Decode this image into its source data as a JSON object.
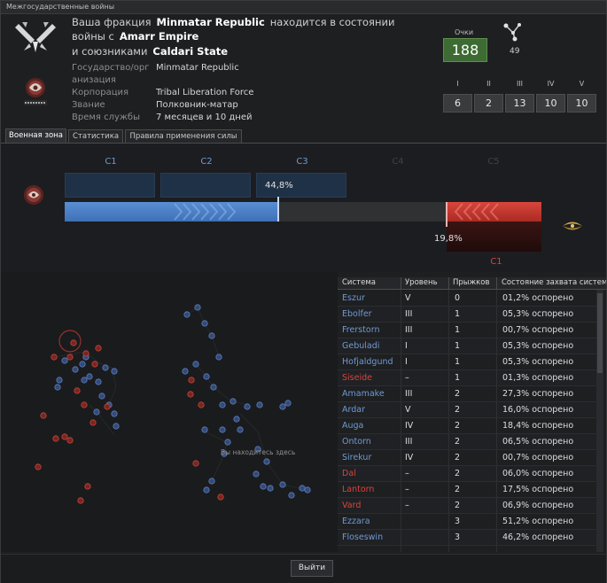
{
  "window": {
    "title": "Межгосударственные войны"
  },
  "header": {
    "line1_pre": "Ваша фракция",
    "line1_faction": "Minmatar Republic",
    "line1_post": "находится в состоянии",
    "line2_pre": "войны с",
    "line2_enemy": "Amarr Empire",
    "line3_pre": "и союзниками",
    "line3_ally": "Caldari State"
  },
  "info": [
    {
      "label": "Государство/орг",
      "value": "Minmatar Republic"
    },
    {
      "label": "анизация",
      "value": ""
    },
    {
      "label": "Корпорация",
      "value": "Tribal Liberation Force"
    },
    {
      "label": "Звание",
      "value": "Полковник-матар"
    },
    {
      "label": "Время службы",
      "value": "7 месяцев и 10 дней"
    }
  ],
  "stats": {
    "points_label": "Очки",
    "points_value": "188",
    "pilots_icon": "pilots-network-icon",
    "pilots_count": "49"
  },
  "ranks": [
    {
      "label": "I",
      "value": "6"
    },
    {
      "label": "II",
      "value": "2"
    },
    {
      "label": "III",
      "value": "13"
    },
    {
      "label": "IV",
      "value": "10"
    },
    {
      "label": "V",
      "value": "10"
    }
  ],
  "tabs": [
    {
      "label": "Военная зона",
      "active": true
    },
    {
      "label": "Статистика",
      "active": false
    },
    {
      "label": "Правила применения силы",
      "active": false
    }
  ],
  "warzone": {
    "levels": [
      "C1",
      "C2",
      "C3",
      "C4",
      "C5"
    ],
    "levels_active": 3,
    "ally_percent_label": "44,8%",
    "ally_percent": 44.8,
    "enemy_percent_label": "19,8%",
    "enemy_percent": 19.8,
    "enemy_level": "C1",
    "colors": {
      "ally": "#4f83c9",
      "enemy": "#c8372f"
    }
  },
  "map": {
    "caption": "Вы находитесь здесь"
  },
  "table": {
    "headers": [
      "Система",
      "Уровень",
      "Прыжков",
      "Состояние захвата систем"
    ],
    "rows": [
      {
        "system": "Eszur",
        "side": "ally",
        "level": "V",
        "jumps": "0",
        "state": "01,2% оспорено"
      },
      {
        "system": "Ebolfer",
        "side": "ally",
        "level": "III",
        "jumps": "1",
        "state": "05,3% оспорено"
      },
      {
        "system": "Frerstorn",
        "side": "ally",
        "level": "III",
        "jumps": "1",
        "state": "00,7% оспорено"
      },
      {
        "system": "Gebuladi",
        "side": "ally",
        "level": "I",
        "jumps": "1",
        "state": "05,3% оспорено"
      },
      {
        "system": "Hofjaldgund",
        "side": "ally",
        "level": "I",
        "jumps": "1",
        "state": "05,3% оспорено"
      },
      {
        "system": "Siseide",
        "side": "enemy",
        "level": "–",
        "jumps": "1",
        "state": "01,3% оспорено"
      },
      {
        "system": "Amamake",
        "side": "ally",
        "level": "III",
        "jumps": "2",
        "state": "27,3% оспорено"
      },
      {
        "system": "Ardar",
        "side": "ally",
        "level": "V",
        "jumps": "2",
        "state": "16,0% оспорено"
      },
      {
        "system": "Auga",
        "side": "ally",
        "level": "IV",
        "jumps": "2",
        "state": "18,4% оспорено"
      },
      {
        "system": "Ontorn",
        "side": "ally",
        "level": "III",
        "jumps": "2",
        "state": "06,5% оспорено"
      },
      {
        "system": "Sirekur",
        "side": "ally",
        "level": "IV",
        "jumps": "2",
        "state": "00,7% оспорено"
      },
      {
        "system": "Dal",
        "side": "enemy",
        "level": "–",
        "jumps": "2",
        "state": "06,0% оспорено"
      },
      {
        "system": "Lantorn",
        "side": "enemy",
        "level": "–",
        "jumps": "2",
        "state": "17,5% оспорено"
      },
      {
        "system": "Vard",
        "side": "enemy",
        "level": "–",
        "jumps": "2",
        "state": "06,9% оспорено"
      },
      {
        "system": "Ezzara",
        "side": "ally",
        "level": "",
        "jumps": "3",
        "state": "51,2% оспорено"
      },
      {
        "system": "Floseswin",
        "side": "ally",
        "level": "",
        "jumps": "3",
        "state": "46,2% оспорено"
      }
    ]
  },
  "footer": {
    "exit_label": "Выйти"
  }
}
